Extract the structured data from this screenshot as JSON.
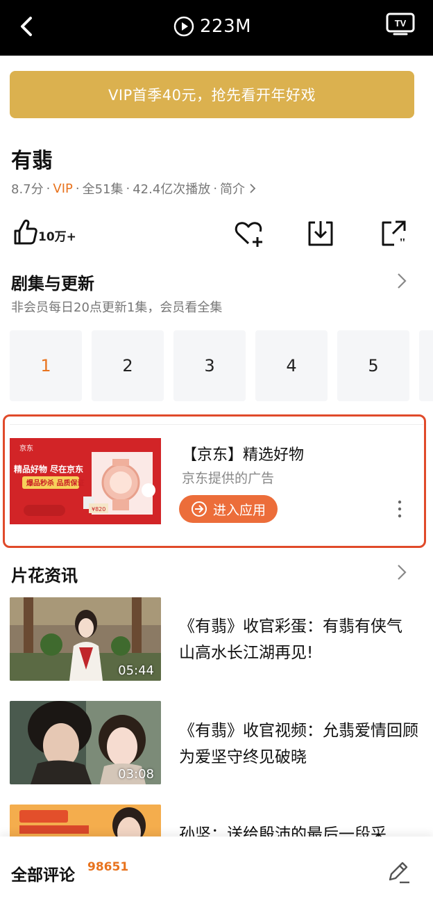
{
  "player": {
    "size_label": "223M"
  },
  "colors": {
    "accent": "#e8731e",
    "vip_banner": "#dbb14f",
    "ad_button": "#ec6d3a",
    "ad_border": "#e04a2a"
  },
  "vip_banner": "VIP首季40元，抢先看开年好戏",
  "show": {
    "title": "有翡",
    "score": "8.7分",
    "vip": "VIP",
    "episodes_total": "全51集",
    "plays": "42.4亿次播放",
    "intro_link": "简介"
  },
  "actions": {
    "like_count": "10万+",
    "icons": [
      "thumbs-up-icon",
      "favorite-heart-plus-icon",
      "download-icon",
      "share-icon"
    ]
  },
  "episodes_section": {
    "title": "剧集与更新",
    "subtitle": "非会员每日20点更新1集，会员看全集",
    "items": [
      "1",
      "2",
      "3",
      "4",
      "5"
    ],
    "selected": "1"
  },
  "ad": {
    "title": "【京东】精选好物",
    "source": "京东提供的广告",
    "button_label": "进入应用",
    "banner": {
      "brand": "京东",
      "headline": "精品好物 尽在京东",
      "tag": "爆品秒杀 品质保证",
      "price": "¥820"
    }
  },
  "news_section": {
    "title": "片花资讯",
    "items": [
      {
        "title": "《有翡》收官彩蛋：有翡有侠气 山高水长江湖再见!",
        "duration": "05:44"
      },
      {
        "title": "《有翡》收官视频：允翡爱情回顾 为爱坚守终见破晓",
        "duration": "03:08"
      },
      {
        "title": "孙坚：送给殷沛的最后一段采",
        "duration": ""
      }
    ]
  },
  "comments": {
    "label": "全部评论",
    "count": "98651"
  }
}
